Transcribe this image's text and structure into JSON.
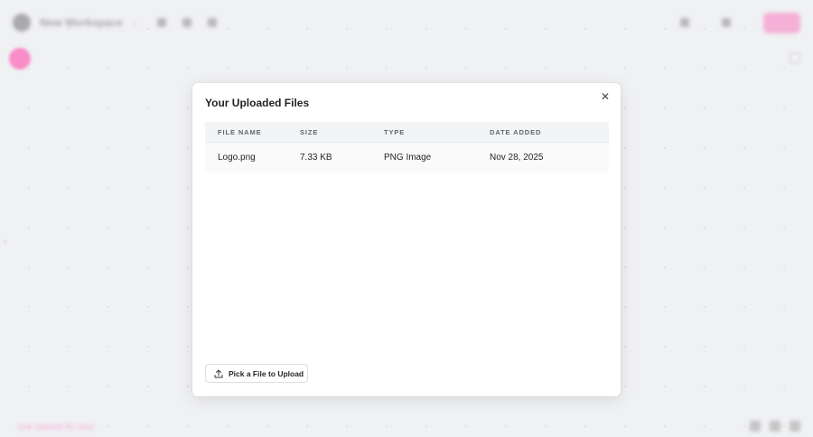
{
  "background": {
    "workspace_name": "New Workspace",
    "bottom_link": "Get started for free"
  },
  "modal": {
    "title": "Your Uploaded Files",
    "close_icon": "close-icon",
    "columns": [
      "File Name",
      "Size",
      "Type",
      "Date Added"
    ],
    "rows": [
      {
        "name": "Logo.png",
        "size": "7.33 KB",
        "type": "PNG Image",
        "date": "Nov 28, 2025"
      }
    ],
    "upload_button": {
      "label": "Pick a File to Upload",
      "icon": "upload-icon"
    }
  },
  "colors": {
    "accent": "#ff3ea5",
    "header_bg": "#f3f4f6",
    "row_bg": "#fafafa"
  }
}
